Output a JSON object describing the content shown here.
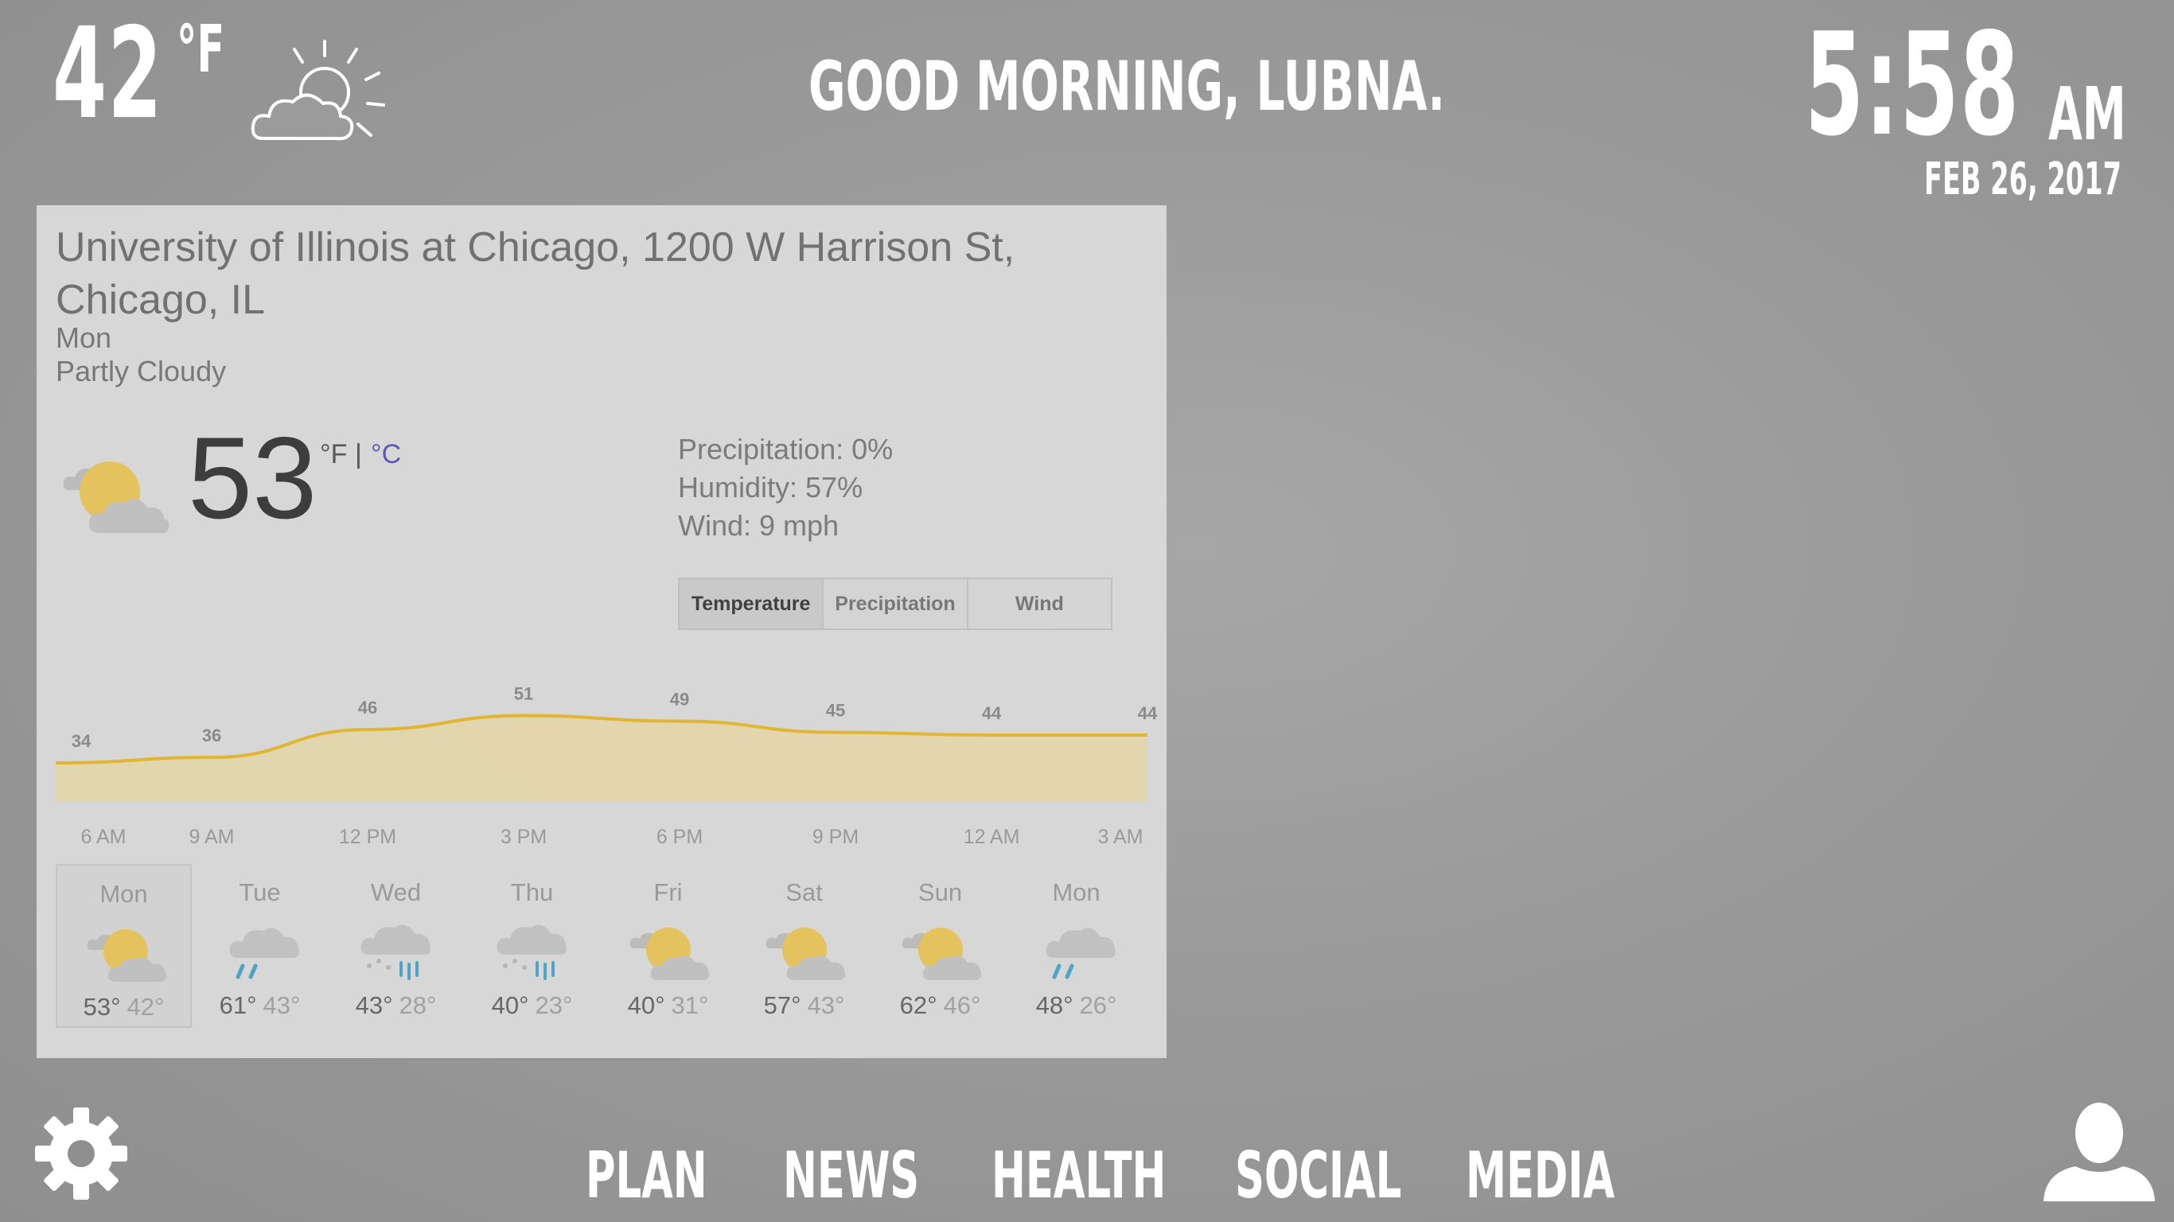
{
  "header": {
    "outside_temp": "42",
    "outside_unit": "°F",
    "outside_icon": "partly-cloudy-icon",
    "greeting": "GOOD MORNING, LUBNA.",
    "time": "5:58",
    "ampm": "AM",
    "date": "FEB 26, 2017"
  },
  "weather": {
    "location": "University of Illinois at Chicago, 1200 W Harrison St, Chicago, IL",
    "day": "Mon",
    "condition": "Partly Cloudy",
    "current_temp": "53",
    "unit_f": "°F",
    "unit_sep": "|",
    "unit_c": "°C",
    "precipitation": "Precipitation: 0%",
    "humidity": "Humidity: 57%",
    "wind": "Wind: 9 mph",
    "tabs": [
      "Temperature",
      "Precipitation",
      "Wind"
    ],
    "active_tab": "Temperature",
    "forecast": [
      {
        "day": "Mon",
        "hi": "53°",
        "lo": "42°",
        "icon": "partly-cloudy-icon"
      },
      {
        "day": "Tue",
        "hi": "61°",
        "lo": "43°",
        "icon": "rain-icon"
      },
      {
        "day": "Wed",
        "hi": "43°",
        "lo": "28°",
        "icon": "snow-rain-icon"
      },
      {
        "day": "Thu",
        "hi": "40°",
        "lo": "23°",
        "icon": "snow-rain-icon"
      },
      {
        "day": "Fri",
        "hi": "40°",
        "lo": "31°",
        "icon": "partly-cloudy-icon"
      },
      {
        "day": "Sat",
        "hi": "57°",
        "lo": "43°",
        "icon": "partly-cloudy-icon"
      },
      {
        "day": "Sun",
        "hi": "62°",
        "lo": "46°",
        "icon": "partly-cloudy-icon"
      },
      {
        "day": "Mon",
        "hi": "48°",
        "lo": "26°",
        "icon": "rain-icon"
      }
    ]
  },
  "chart_data": {
    "type": "area",
    "categories": [
      "6 AM",
      "9 AM",
      "12 PM",
      "3 PM",
      "6 PM",
      "9 PM",
      "12 AM",
      "3 AM"
    ],
    "values": [
      34,
      36,
      46,
      51,
      49,
      45,
      44,
      44
    ],
    "ylim": [
      20,
      60
    ],
    "colors": {
      "line": "#e3b72e",
      "fill": "#e6d9b0"
    }
  },
  "nav": {
    "items": [
      "PLAN",
      "NEWS",
      "HEALTH",
      "SOCIAL",
      "MEDIA"
    ],
    "settings_icon": "gear-icon",
    "profile_icon": "user-icon"
  }
}
